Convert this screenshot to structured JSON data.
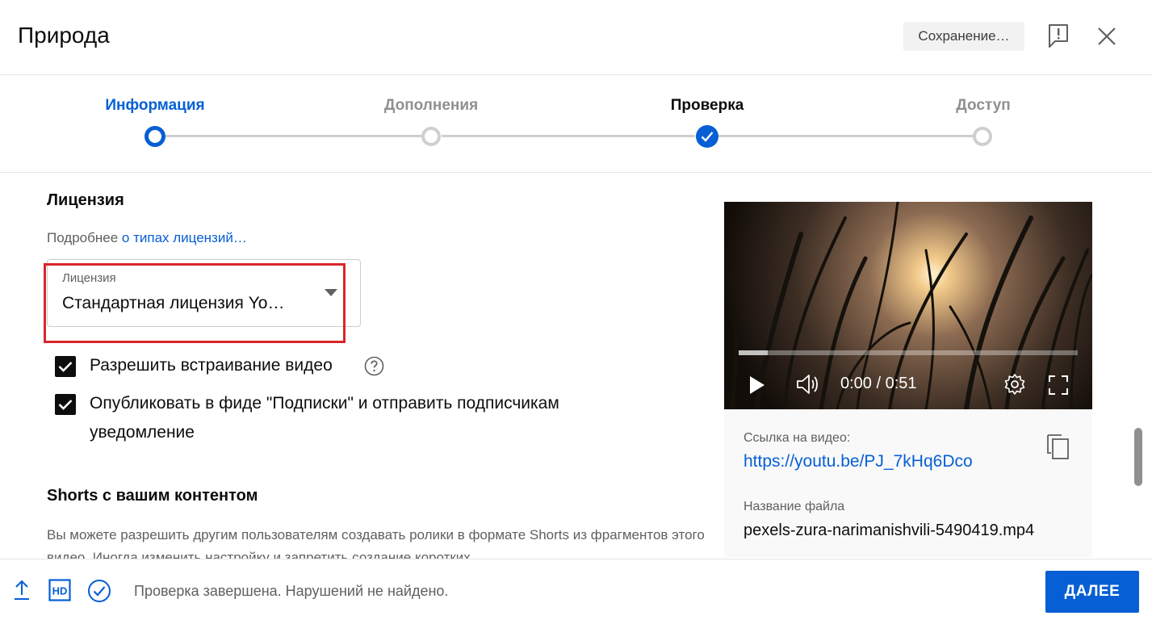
{
  "header": {
    "title": "Природа",
    "save_status": "Сохранение…"
  },
  "stepper": {
    "steps": [
      {
        "label": "Информация",
        "state": "current"
      },
      {
        "label": "Дополнения",
        "state": "inactive"
      },
      {
        "label": "Проверка",
        "state": "done"
      },
      {
        "label": "Доступ",
        "state": "inactive"
      }
    ]
  },
  "license": {
    "heading": "Лицензия",
    "more_prefix": "Подробнее",
    "more_link": "о типах лицензий…",
    "select_label": "Лицензия",
    "select_value": "Стандартная лицензия Yo…"
  },
  "checkboxes": {
    "embed_label": "Разрешить встраивание видео",
    "publish_line1": "Опубликовать в фиде \"Подписки\" и отправить подписчикам",
    "publish_line2": "уведомление"
  },
  "shorts": {
    "heading": "Shorts с вашим контентом",
    "text": "Вы можете разрешить другим пользователям создавать ролики в формате Shorts из фрагментов этого видео. Иногда изменить настройку и запретить создание коротких"
  },
  "video": {
    "time": "0:00 / 0:51",
    "progress": 0.085,
    "link_label": "Ссылка на видео:",
    "link": "https://youtu.be/PJ_7kHq6Dco",
    "file_label": "Название файла",
    "file_name": "pexels-zura-narimanishvili-5490419.mp4"
  },
  "footer": {
    "status": "Проверка завершена. Нарушений не найдено.",
    "next_label": "ДАЛЕЕ"
  },
  "colors": {
    "accent": "#065fd4",
    "highlight": "#d9252b"
  }
}
